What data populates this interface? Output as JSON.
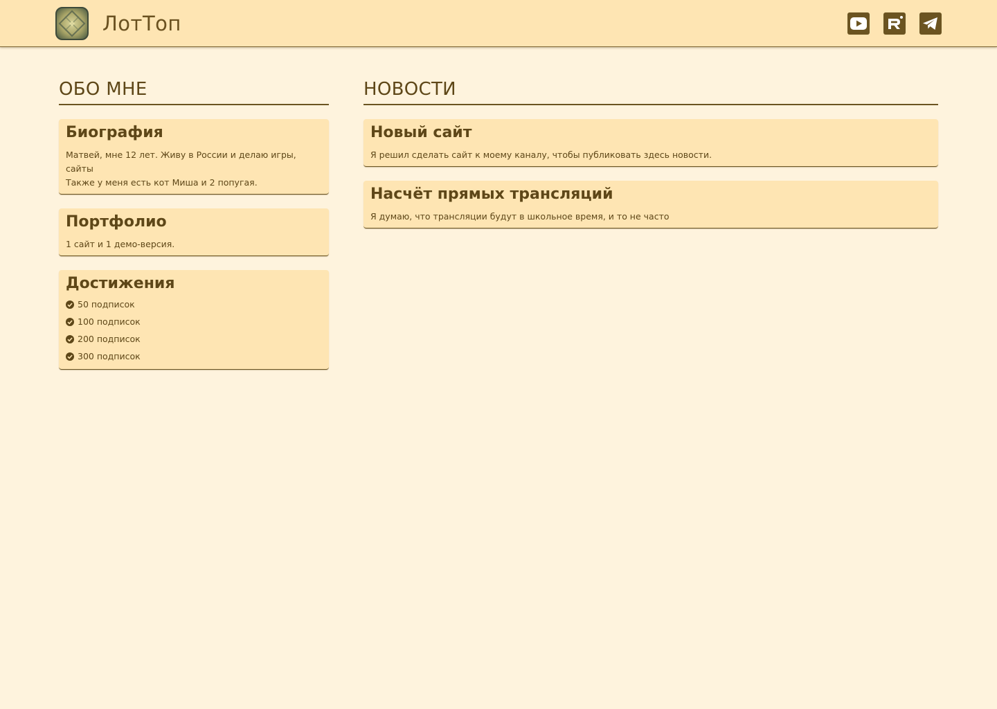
{
  "header": {
    "site_title": "ЛотТоп",
    "logo_icon": "site-logo-icon",
    "social": [
      {
        "name": "youtube-icon"
      },
      {
        "name": "rutube-icon"
      },
      {
        "name": "telegram-icon"
      }
    ]
  },
  "colors": {
    "header_bg": "#fee5b3",
    "page_bg": "#fef3dd",
    "card_bg": "#fee5b3",
    "text": "#5e4718",
    "accent": "#6b5421"
  },
  "about": {
    "section_title": "ОБО МНЕ",
    "bio": {
      "title": "Биография",
      "line1": "Матвей, мне 12 лет. Живу в России и делаю игры, сайты",
      "line2": "Также у меня есть кот Миша и 2 попугая."
    },
    "portfolio": {
      "title": "Портфолио",
      "text": "1 сайт и 1 демо-версия."
    },
    "achievements": {
      "title": "Достижения",
      "items": [
        "50 подписок",
        "100 подписок",
        "200 подписок",
        "300 подписок"
      ]
    }
  },
  "news": {
    "section_title": "НОВОСТИ",
    "items": [
      {
        "title": "Новый сайт",
        "text": "Я решил сделать сайт к моему каналу, чтобы публиковать здесь новости."
      },
      {
        "title": "Насчёт прямых трансляций",
        "text": "Я думаю, что трансляции будут в школьное время, и то не часто"
      }
    ]
  }
}
